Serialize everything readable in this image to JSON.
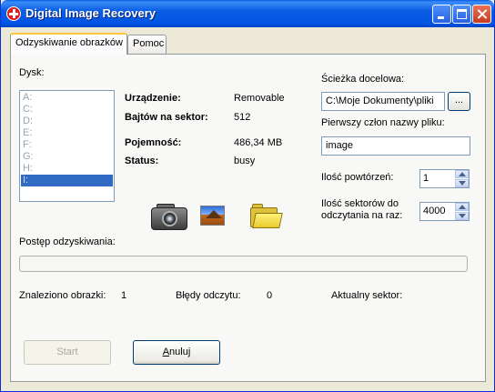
{
  "window": {
    "title": "Digital Image Recovery",
    "app_icon": "red-cross-icon"
  },
  "tabs": [
    {
      "label": "Odzyskiwanie obrazków",
      "active": true
    },
    {
      "label": "Pomoc",
      "active": false
    }
  ],
  "disk": {
    "label": "Dysk:",
    "drives": [
      "A:",
      "C:",
      "D:",
      "E:",
      "F:",
      "G:",
      "H:",
      "I:"
    ],
    "selected": "I:"
  },
  "device_info": {
    "device_label": "Urządzenie:",
    "device_value": "Removable",
    "bytes_label": "Bajtów na sektor:",
    "bytes_value": "512",
    "capacity_label": "Pojemność:",
    "capacity_value": "486,34 MB",
    "status_label": "Status:",
    "status_value": "busy"
  },
  "icons": [
    "camera-icon",
    "image-icon",
    "folder-icon"
  ],
  "target": {
    "path_label": "Ścieżka docelowa:",
    "path_value": "C:\\Moje Dokumenty\\pliki",
    "browse_label": "...",
    "prefix_label": "Pierwszy człon nazwy pliku:",
    "prefix_value": "image",
    "repeats_label": "Ilość powtórzeń:",
    "repeats_value": "1",
    "sectors_label_1": "Ilość sektorów do",
    "sectors_label_2": "odczytania na raz:",
    "sectors_value": "4000"
  },
  "progress": {
    "label": "Postęp odzyskiwania:",
    "value": 0
  },
  "stats": {
    "found_label": "Znaleziono obrazki:",
    "found_value": "1",
    "errors_label": "Błędy odczytu:",
    "errors_value": "0",
    "sector_label": "Aktualny sektor:",
    "sector_value": ""
  },
  "buttons": {
    "start": "Start",
    "cancel_prefix": "A",
    "cancel_rest": "nuluj"
  },
  "colors": {
    "title_bar": "#0054e3",
    "selection": "#316ac5",
    "window_bg": "#ece9d8"
  }
}
